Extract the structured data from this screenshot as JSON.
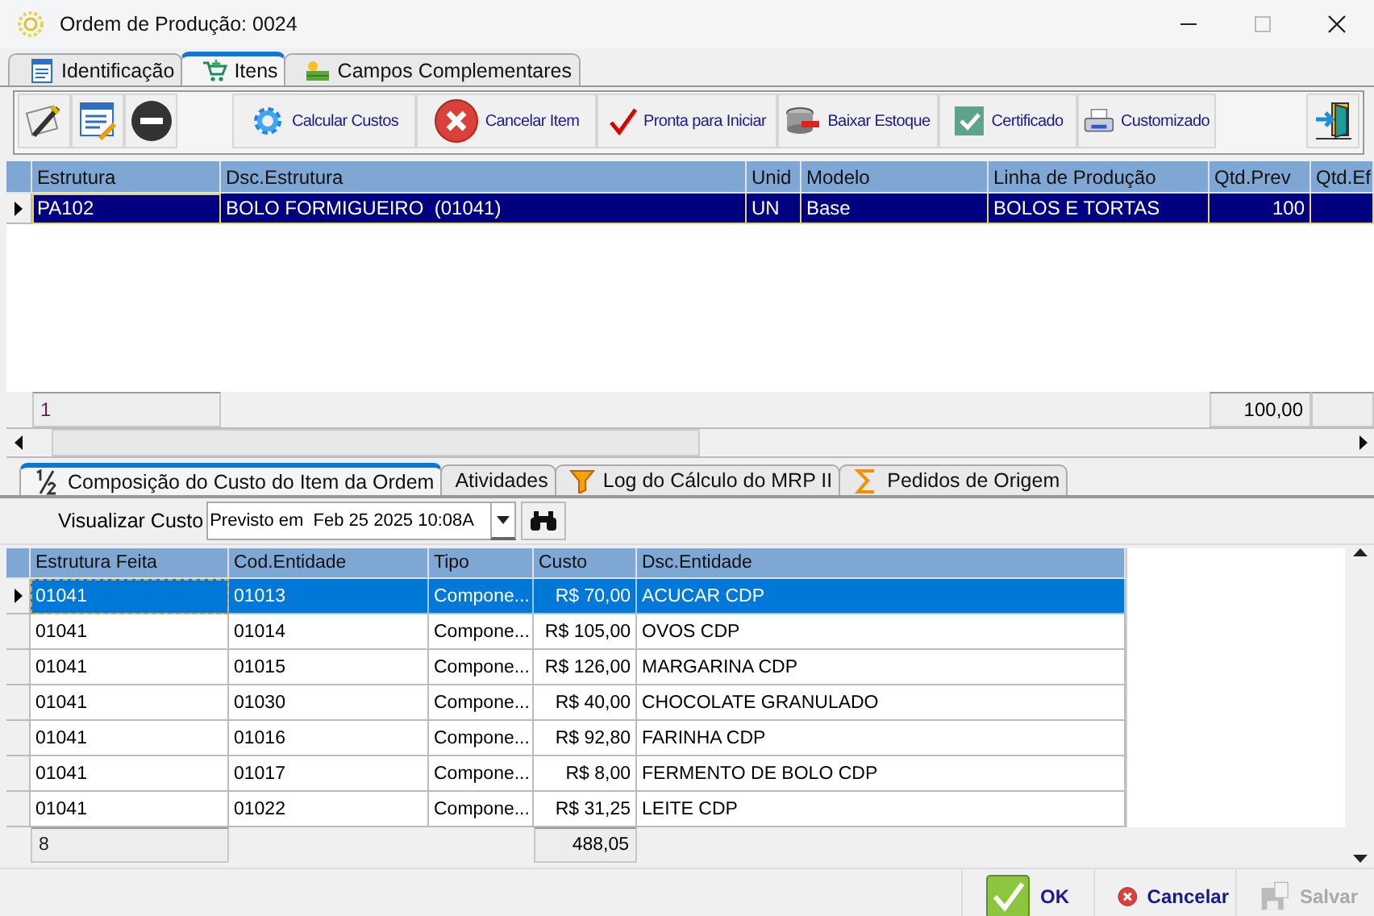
{
  "window": {
    "title": "Ordem de Produção: 0024"
  },
  "tabs": [
    {
      "label": "Identificação",
      "selected": false
    },
    {
      "label": "Itens",
      "selected": true
    },
    {
      "label": "Campos Complementares",
      "selected": false
    }
  ],
  "toolbar": {
    "buttons": [
      "Calcular Custos",
      "Cancelar Item",
      "Pronta para Iniciar",
      "Baixar Estoque",
      "Certificado",
      "Customizado"
    ]
  },
  "items_grid": {
    "columns": [
      "Estrutura",
      "Dsc.Estrutura",
      "Unid",
      "Modelo",
      "Linha de Produção",
      "Qtd.Prev",
      "Qtd.Ef"
    ],
    "rows": [
      {
        "cells": [
          "PA102",
          "BOLO FORMIGUEIRO  (01041)",
          "UN",
          "Base",
          "BOLOS E TORTAS",
          "100",
          ""
        ],
        "selected": true
      }
    ],
    "footer": {
      "count": "1",
      "total": "100,00"
    }
  },
  "detail_tabs": [
    {
      "label": "Composição do Custo do Item da Ordem",
      "selected": true
    },
    {
      "label": "Atividades",
      "selected": false
    },
    {
      "label": "Log do Cálculo do MRP II",
      "selected": false
    },
    {
      "label": "Pedidos de Origem",
      "selected": false
    }
  ],
  "view_cost": {
    "label": "Visualizar Custo",
    "value": "Previsto em  Feb 25 2025 10:08A"
  },
  "cost_grid": {
    "columns": [
      "Estrutura Feita",
      "Cod.Entidade",
      "Tipo",
      "Custo",
      "Dsc.Entidade"
    ],
    "rows": [
      {
        "cells": [
          "01041",
          "01013",
          "Compone...",
          "R$ 70,00",
          "ACUCAR CDP"
        ],
        "selected": true
      },
      {
        "cells": [
          "01041",
          "01014",
          "Compone...",
          "R$ 105,00",
          "OVOS CDP"
        ],
        "selected": false
      },
      {
        "cells": [
          "01041",
          "01015",
          "Compone...",
          "R$ 126,00",
          "MARGARINA CDP"
        ],
        "selected": false
      },
      {
        "cells": [
          "01041",
          "01030",
          "Compone...",
          "R$ 40,00",
          "CHOCOLATE GRANULADO"
        ],
        "selected": false
      },
      {
        "cells": [
          "01041",
          "01016",
          "Compone...",
          "R$ 92,80",
          "FARINHA CDP"
        ],
        "selected": false
      },
      {
        "cells": [
          "01041",
          "01017",
          "Compone...",
          "R$ 8,00",
          "FERMENTO DE BOLO CDP"
        ],
        "selected": false
      },
      {
        "cells": [
          "01041",
          "01022",
          "Compone...",
          "R$ 31,25",
          "LEITE CDP"
        ],
        "selected": false
      }
    ],
    "footer": {
      "count": "8",
      "total": "488,05"
    }
  },
  "actions": [
    {
      "label": "OK",
      "disabled": false
    },
    {
      "label": "Cancelar",
      "disabled": false
    },
    {
      "label": "Salvar",
      "disabled": true
    }
  ]
}
